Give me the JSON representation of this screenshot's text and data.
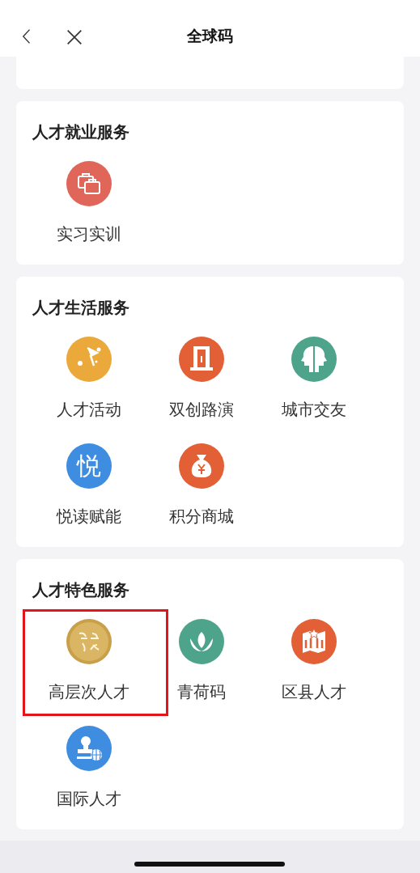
{
  "header": {
    "title": "全球码"
  },
  "sections": [
    {
      "title": "人才就业服务",
      "items": [
        {
          "label": "实习实训",
          "kind": "briefcase",
          "color": "#e0665a",
          "highlighted": false
        }
      ]
    },
    {
      "title": "人才生活服务",
      "items": [
        {
          "label": "人才活动",
          "kind": "flag",
          "color": "#eaa93a",
          "highlighted": false
        },
        {
          "label": "双创路演",
          "kind": "door",
          "color": "#e35f35",
          "highlighted": false
        },
        {
          "label": "城市交友",
          "kind": "heads",
          "color": "#4da48b",
          "highlighted": false
        },
        {
          "label": "悦读赋能",
          "kind": "glyph",
          "glyph": "悦",
          "color": "#3e8de0",
          "highlighted": false
        },
        {
          "label": "积分商城",
          "kind": "moneybag",
          "color": "#e35f35",
          "highlighted": false
        }
      ]
    },
    {
      "title": "人才特色服务",
      "items": [
        {
          "label": "高层次人才",
          "kind": "emblem",
          "color": "#c9a04a",
          "highlighted": true
        },
        {
          "label": "青荷码",
          "kind": "lotus",
          "color": "#4da48b",
          "highlighted": false
        },
        {
          "label": "区县人才",
          "kind": "map",
          "color": "#e35f35",
          "highlighted": false
        },
        {
          "label": "国际人才",
          "kind": "stamp",
          "color": "#3e8de0",
          "highlighted": false
        }
      ]
    }
  ]
}
